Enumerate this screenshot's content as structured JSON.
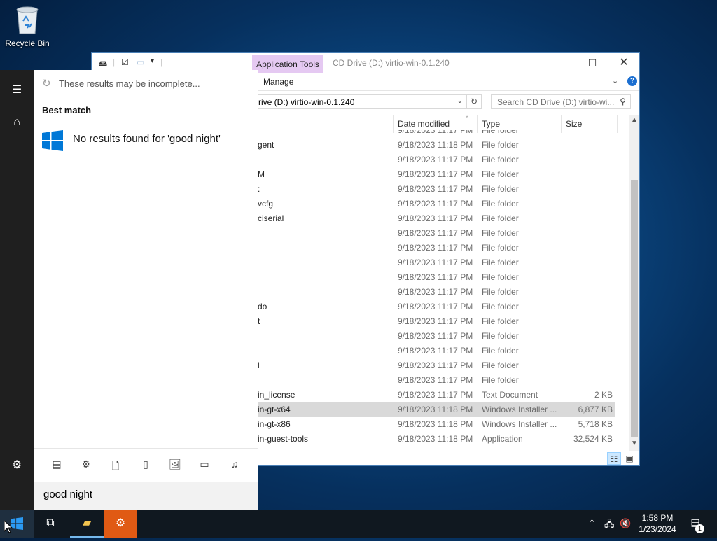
{
  "desktop": {
    "recycle_bin_label": "Recycle Bin"
  },
  "explorer": {
    "tab_application_tools": "Application Tools",
    "title": "CD Drive (D:) virtio-win-0.1.240",
    "ribbon_manage": "Manage",
    "address_text": "rive (D:) virtio-win-0.1.240",
    "search_placeholder": "Search CD Drive (D:) virtio-wi...",
    "columns": {
      "date": "Date modified",
      "type": "Type",
      "size": "Size"
    },
    "rows": [
      {
        "name": "",
        "date": "9/18/2023 11:17 PM",
        "type": "File folder",
        "size": ""
      },
      {
        "name": "gent",
        "date": "9/18/2023 11:18 PM",
        "type": "File folder",
        "size": ""
      },
      {
        "name": "",
        "date": "9/18/2023 11:17 PM",
        "type": "File folder",
        "size": ""
      },
      {
        "name": "M",
        "date": "9/18/2023 11:17 PM",
        "type": "File folder",
        "size": ""
      },
      {
        "name": ":",
        "date": "9/18/2023 11:17 PM",
        "type": "File folder",
        "size": ""
      },
      {
        "name": "vcfg",
        "date": "9/18/2023 11:17 PM",
        "type": "File folder",
        "size": ""
      },
      {
        "name": "ciserial",
        "date": "9/18/2023 11:17 PM",
        "type": "File folder",
        "size": ""
      },
      {
        "name": "",
        "date": "9/18/2023 11:17 PM",
        "type": "File folder",
        "size": ""
      },
      {
        "name": "",
        "date": "9/18/2023 11:17 PM",
        "type": "File folder",
        "size": ""
      },
      {
        "name": "",
        "date": "9/18/2023 11:17 PM",
        "type": "File folder",
        "size": ""
      },
      {
        "name": "",
        "date": "9/18/2023 11:17 PM",
        "type": "File folder",
        "size": ""
      },
      {
        "name": "",
        "date": "9/18/2023 11:17 PM",
        "type": "File folder",
        "size": ""
      },
      {
        "name": "do",
        "date": "9/18/2023 11:17 PM",
        "type": "File folder",
        "size": ""
      },
      {
        "name": "t",
        "date": "9/18/2023 11:17 PM",
        "type": "File folder",
        "size": ""
      },
      {
        "name": "",
        "date": "9/18/2023 11:17 PM",
        "type": "File folder",
        "size": ""
      },
      {
        "name": "",
        "date": "9/18/2023 11:17 PM",
        "type": "File folder",
        "size": ""
      },
      {
        "name": "l",
        "date": "9/18/2023 11:17 PM",
        "type": "File folder",
        "size": ""
      },
      {
        "name": "",
        "date": "9/18/2023 11:17 PM",
        "type": "File folder",
        "size": ""
      },
      {
        "name": "in_license",
        "date": "9/18/2023 11:17 PM",
        "type": "Text Document",
        "size": "2 KB"
      },
      {
        "name": "in-gt-x64",
        "date": "9/18/2023 11:18 PM",
        "type": "Windows Installer ...",
        "size": "6,877 KB",
        "selected": true
      },
      {
        "name": "in-gt-x86",
        "date": "9/18/2023 11:18 PM",
        "type": "Windows Installer ...",
        "size": "5,718 KB"
      },
      {
        "name": "in-guest-tools",
        "date": "9/18/2023 11:18 PM",
        "type": "Application",
        "size": "32,524 KB"
      }
    ]
  },
  "start": {
    "incomplete_notice": "These results may be incomplete...",
    "best_match_heading": "Best match",
    "no_results_text": "No results found for 'good night'",
    "search_value": "good night"
  },
  "taskbar": {
    "time": "1:58 PM",
    "date": "1/23/2024",
    "notification_count": "1"
  },
  "colors": {
    "app_tools_tab": "#e5c9f2",
    "selection": "#d9d9d9",
    "taskbar": "#101820",
    "start_rail": "#1f1f1f",
    "accent": "#0078d7"
  }
}
